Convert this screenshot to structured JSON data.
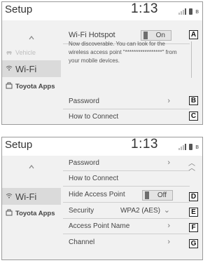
{
  "screen1": {
    "title": "Setup",
    "clock": "1:13",
    "sidebar": {
      "items": [
        {
          "label": "Vehicle",
          "icon": "car-icon"
        },
        {
          "label": "Wi-Fi",
          "icon": "wifi-icon"
        },
        {
          "label": "Toyota Apps",
          "icon": "apps-icon"
        }
      ],
      "active": "Wi-Fi"
    },
    "hotspot": {
      "label": "Wi-Fi Hotspot",
      "value": "On",
      "callout": "A"
    },
    "message": "Now discoverable. You can look for the wireless access point \"*****************\" from your mobile devices.",
    "password": {
      "label": "Password",
      "callout": "B"
    },
    "how_to_connect": {
      "label": "How to Connect",
      "callout": "C"
    }
  },
  "screen2": {
    "title": "Setup",
    "clock": "1:13",
    "sidebar": {
      "items": [
        {
          "label": "Wi-Fi",
          "icon": "wifi-icon"
        },
        {
          "label": "Toyota Apps",
          "icon": "apps-icon"
        }
      ],
      "active": "Wi-Fi"
    },
    "rows": {
      "password": "Password",
      "how_to_connect": "How to Connect",
      "hide_ap": {
        "label": "Hide Access Point",
        "value": "Off",
        "callout": "D"
      },
      "security": {
        "label": "Security",
        "value": "WPA2 (AES)",
        "callout": "E"
      },
      "ap_name": {
        "label": "Access Point Name",
        "callout": "F"
      },
      "channel": {
        "label": "Channel",
        "callout": "G"
      }
    }
  },
  "colors": {
    "panel_bg": "#f1f1f1",
    "active_bg": "#dadada",
    "header_bg": "#ffffff"
  }
}
